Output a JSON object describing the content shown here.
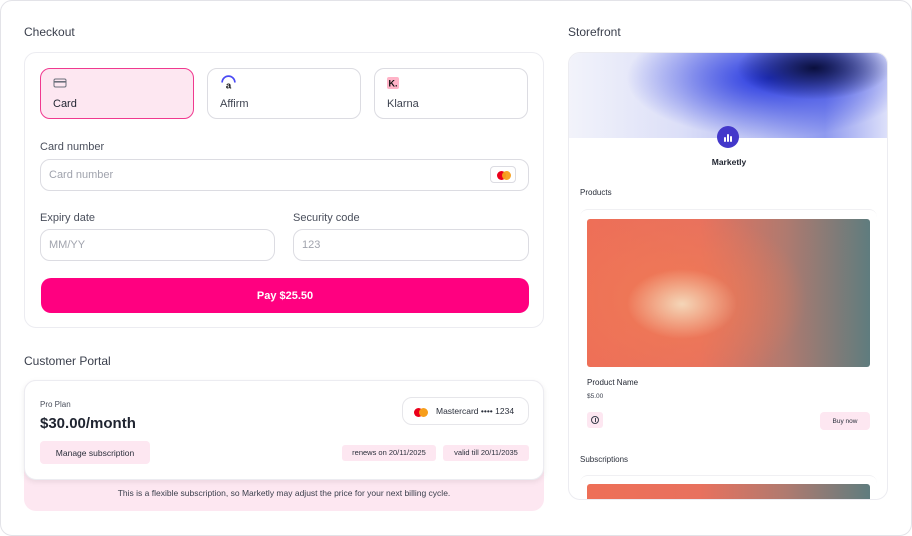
{
  "checkout": {
    "title": "Checkout",
    "methods": [
      {
        "label": "Card",
        "icon": "credit-card-icon",
        "selected": true
      },
      {
        "label": "Affirm",
        "icon": "affirm-logo-icon",
        "selected": false
      },
      {
        "label": "Klarna",
        "icon": "klarna-logo-icon",
        "selected": false
      }
    ],
    "card_number": {
      "label": "Card number",
      "placeholder": "Card number",
      "value": ""
    },
    "expiry": {
      "label": "Expiry date",
      "placeholder": "MM/YY",
      "value": ""
    },
    "security": {
      "label": "Security code",
      "placeholder": "123",
      "value": ""
    },
    "pay_label": "Pay $25.50",
    "card_brand_icon": "mastercard-icon"
  },
  "portal": {
    "title": "Customer Portal",
    "plan_name": "Pro Plan",
    "price": "$30.00/month",
    "card_text": "Mastercard •••• 1234",
    "manage_label": "Manage subscription",
    "renews": "renews on 20/11/2025",
    "valid": "valid till 20/11/2035",
    "note": "This is a flexible subscription, so Marketly may adjust the price for your next billing cycle."
  },
  "storefront": {
    "title": "Storefront",
    "store_name": "Marketly",
    "products_label": "Products",
    "product": {
      "name": "Product Name",
      "price": "$5.00",
      "buy_label": "Buy now"
    },
    "subscriptions_label": "Subscriptions"
  },
  "colors": {
    "accent": "#ff0080",
    "accent_light": "#fde7f1",
    "logo": "#4338ca"
  }
}
